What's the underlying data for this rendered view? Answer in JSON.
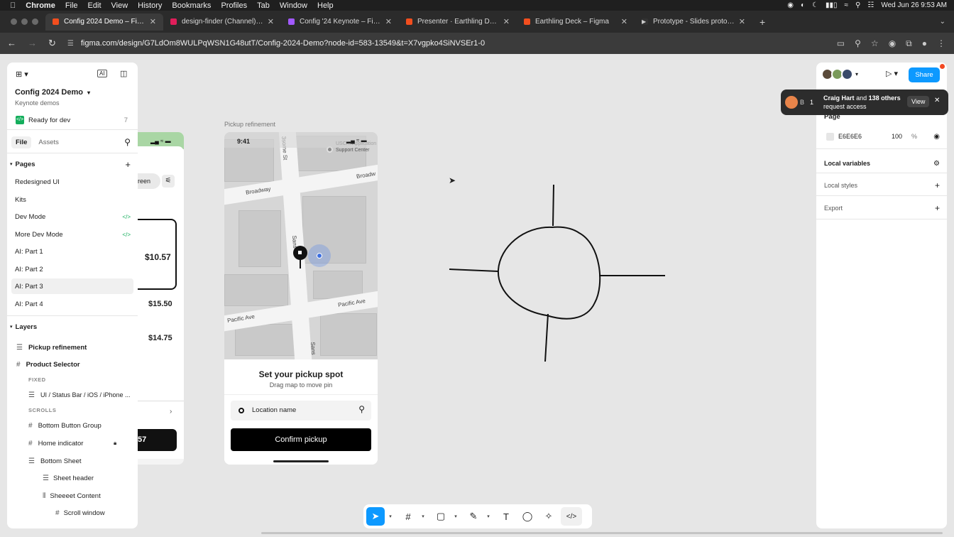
{
  "macos_menubar": {
    "app": "Chrome",
    "items": [
      "File",
      "Edit",
      "View",
      "History",
      "Bookmarks",
      "Profiles",
      "Tab",
      "Window",
      "Help"
    ],
    "clock": "Wed Jun 26  9:53 AM"
  },
  "browser": {
    "tabs": [
      {
        "title": "Config 2024 Demo – Figma",
        "color": "#f24e1e",
        "active": true
      },
      {
        "title": "design-finder (Channel) - Ub",
        "color": "#e01e5a",
        "active": false
      },
      {
        "title": "Config '24 Keynote – Figma",
        "color": "#a259ff",
        "active": false
      },
      {
        "title": "Presenter · Earthling Deck – F",
        "color": "#f24e1e",
        "active": false
      },
      {
        "title": "Earthling Deck – Figma",
        "color": "#f24e1e",
        "active": false
      },
      {
        "title": "Prototype - Slides prototype",
        "color": "#333333",
        "active": false
      }
    ],
    "url": "figma.com/design/G7LdOm8WULPqWSN1G48utT/Config-2024-Demo?node-id=583-13549&t=X7vgpko4SiNVSEr1-0"
  },
  "left_panel": {
    "project_name": "Config 2024 Demo",
    "project_sub": "Keynote demos",
    "ready_for_dev": "Ready for dev",
    "ready_count": "7",
    "tabs": {
      "file": "File",
      "assets": "Assets"
    },
    "pages_header": "Pages",
    "pages": [
      {
        "name": "Redesigned UI",
        "dev": false
      },
      {
        "name": "Kits",
        "dev": false
      },
      {
        "name": "Dev Mode",
        "dev": true
      },
      {
        "name": "More Dev Mode",
        "dev": true
      },
      {
        "name": "AI: Part 1",
        "dev": false
      },
      {
        "name": "AI: Part 2",
        "dev": false
      },
      {
        "name": "AI: Part 3",
        "dev": false,
        "selected": true
      },
      {
        "name": "AI: Part 4",
        "dev": false
      }
    ],
    "layers_header": "Layers",
    "layers": {
      "pickup": "Pickup refinement",
      "product_selector": "Product Selector",
      "fixed": "FIXED",
      "status_bar": "UI / Status Bar / iOS / iPhone ...",
      "scrolls": "SCROLLS",
      "bottom_button_group": "Bottom Button Group",
      "home_indicator": "Home indicator",
      "bottom_sheet": "Bottom Sheet",
      "sheet_header": "Sheet header",
      "sheet_content": "Sheeeet Content",
      "scroll_window": "Scroll window"
    }
  },
  "canvas": {
    "frame_label": "Pickup refinement",
    "behind_frame": {
      "pill": "reen",
      "price1": "$10.57",
      "price2": "$15.50",
      "price3": "$14.75",
      "btn": "57"
    },
    "phone": {
      "time": "9:41",
      "street_1": "Broadway",
      "street_2": "Broadw",
      "street_3": "3some St",
      "street_4": "Sans",
      "street_5": "Pacific Ave",
      "street_6": "Pacific Ave",
      "street_7": "Sans",
      "poi": "USCIS Application Support Center",
      "sheet_title": "Set your pickup spot",
      "sheet_sub": "Drag map to move pin",
      "location_placeholder": "Location name",
      "confirm": "Confirm pickup"
    }
  },
  "right_panel": {
    "share": "Share",
    "page_label": "Page",
    "page_color": "E6E6E6",
    "page_opacity": "100",
    "percent": "%",
    "local_variables": "Local variables",
    "local_styles": "Local styles",
    "export": "Export"
  },
  "toast": {
    "name": "Craig Hart",
    "mid": "and",
    "others": "138 others",
    "line2": "request access",
    "view": "View",
    "avatar_letter": "B",
    "count": "1"
  },
  "colors": {
    "accent": "#0d99ff",
    "dev_green": "#14ae5c"
  }
}
